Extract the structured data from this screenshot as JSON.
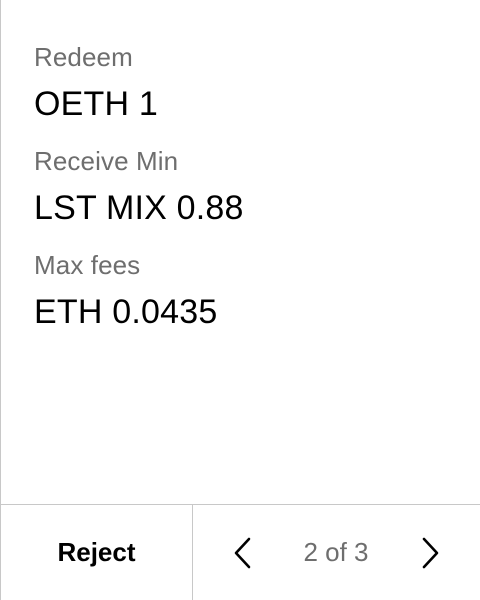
{
  "fields": [
    {
      "label": "Redeem",
      "value": "OETH 1"
    },
    {
      "label": "Receive Min",
      "value": "LST MIX 0.88"
    },
    {
      "label": "Max fees",
      "value": "ETH 0.0435"
    }
  ],
  "footer": {
    "reject_label": "Reject",
    "pager_text": "2 of 3",
    "prev_icon": "chevron-left-icon",
    "next_icon": "chevron-right-icon"
  },
  "colors": {
    "label": "#6e6e6e",
    "value": "#000000",
    "divider": "#c8c8c8",
    "background": "#ffffff"
  }
}
